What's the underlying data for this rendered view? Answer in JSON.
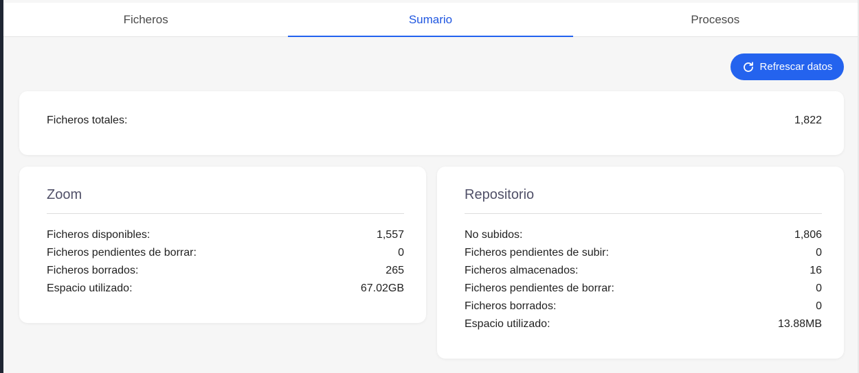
{
  "tabs": [
    {
      "label": "Ficheros",
      "active": false
    },
    {
      "label": "Sumario",
      "active": true
    },
    {
      "label": "Procesos",
      "active": false
    }
  ],
  "refresh_button": {
    "label": "Refrescar datos",
    "icon": "refresh-icon"
  },
  "total": {
    "label": "Ficheros totales:",
    "value": "1,822"
  },
  "zoom": {
    "title": "Zoom",
    "rows": [
      {
        "label": "Ficheros disponibles:",
        "value": "1,557"
      },
      {
        "label": "Ficheros pendientes de borrar:",
        "value": "0"
      },
      {
        "label": "Ficheros borrados:",
        "value": "265"
      },
      {
        "label": "Espacio utilizado:",
        "value": "67.02GB"
      }
    ]
  },
  "repositorio": {
    "title": "Repositorio",
    "rows": [
      {
        "label": "No subidos:",
        "value": "1,806"
      },
      {
        "label": "Ficheros pendientes de subir:",
        "value": "0"
      },
      {
        "label": "Ficheros almacenados:",
        "value": "16"
      },
      {
        "label": "Ficheros pendientes de borrar:",
        "value": "0"
      },
      {
        "label": "Ficheros borrados:",
        "value": "0"
      },
      {
        "label": "Espacio utilizado:",
        "value": "13.88MB"
      }
    ]
  },
  "colors": {
    "accent": "#2463ee",
    "background": "#f6f6f6",
    "card": "#ffffff"
  }
}
